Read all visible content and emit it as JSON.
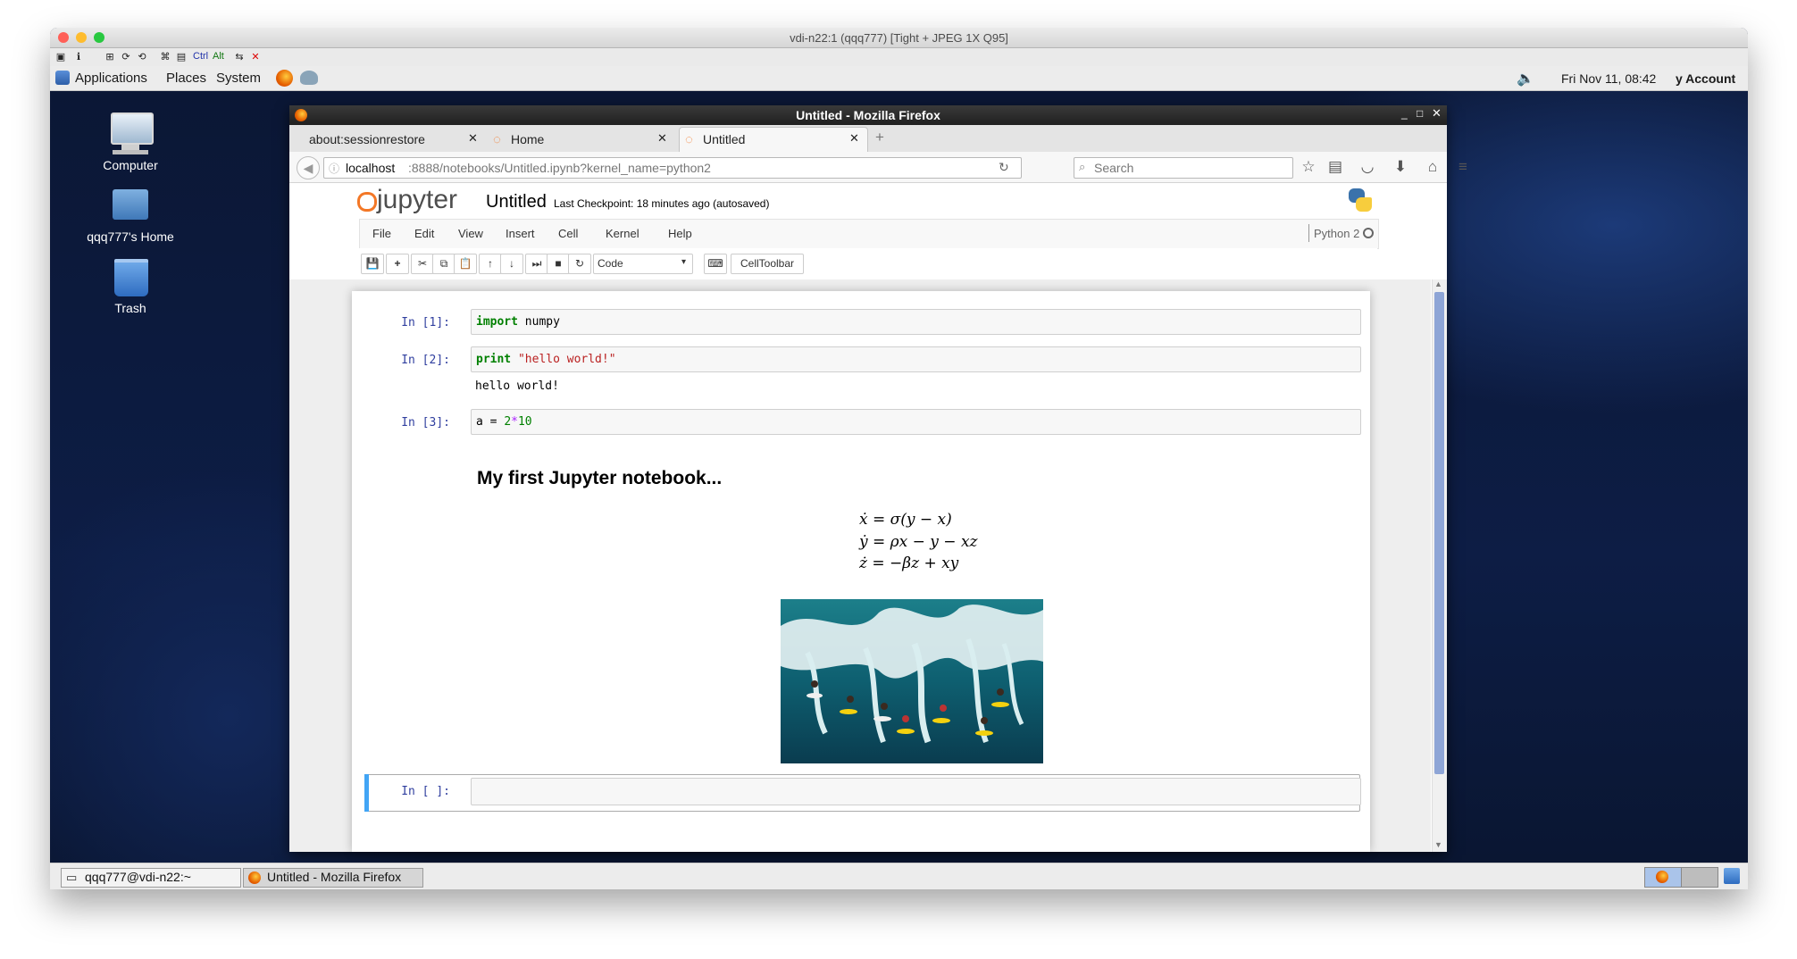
{
  "vnc": {
    "title": "vdi-n22:1 (qqq777) [Tight + JPEG 1X Q95]"
  },
  "toolbar": {
    "ctrl": "Ctrl",
    "alt": "Alt"
  },
  "panel": {
    "menus": [
      "Applications",
      "Places",
      "System"
    ],
    "datetime": "Fri Nov 11, 08:42",
    "account": "y Account"
  },
  "desktop": {
    "icons": [
      {
        "label": "Computer",
        "icon": "computer-icon"
      },
      {
        "label": "qqq777's Home",
        "icon": "home-folder-icon"
      },
      {
        "label": "Trash",
        "icon": "trash-icon"
      }
    ]
  },
  "firefox": {
    "title": "Untitled - Mozilla Firefox",
    "tabs": [
      {
        "label": "about:sessionrestore",
        "active": false
      },
      {
        "label": "Home",
        "active": false
      },
      {
        "label": "Untitled",
        "active": true
      }
    ],
    "url_host": "localhost",
    "url_rest": ":8888/notebooks/Untitled.ipynb?kernel_name=python2",
    "search_placeholder": "Search"
  },
  "jupyter": {
    "logo_text": "jupyter",
    "notebook_name": "Untitled",
    "checkpoint": "Last Checkpoint: 18 minutes ago (autosaved)",
    "menus": [
      "File",
      "Edit",
      "View",
      "Insert",
      "Cell",
      "Kernel",
      "Help"
    ],
    "kernel": "Python 2",
    "cell_type": "Code",
    "celltoolbar": "CellToolbar",
    "cells": [
      {
        "prompt": "In [1]:",
        "kw": "import",
        "rest": " numpy"
      },
      {
        "prompt": "In [2]:",
        "kw": "print",
        "str": " \"hello world!\"",
        "output": "hello world!"
      },
      {
        "prompt": "In [3]:",
        "pre": "a = ",
        "num1": "2",
        "op": "*",
        "num2": "10"
      },
      {
        "prompt": "In [ ]:"
      }
    ],
    "markdown_heading": "My first Jupyter notebook...",
    "equations": [
      "ẋ = σ(y − x)",
      "ẏ = ρx − y − xz",
      "ż = −βz + xy"
    ],
    "image": "surfers-wave-image"
  },
  "taskbar": {
    "items": [
      "qqq777@vdi-n22:~",
      "Untitled - Mozilla Firefox"
    ]
  },
  "colors": {
    "jupyter_orange": "#f37726",
    "prompt_blue": "#303f9f",
    "selected_cell_bar": "#42a5f5"
  }
}
